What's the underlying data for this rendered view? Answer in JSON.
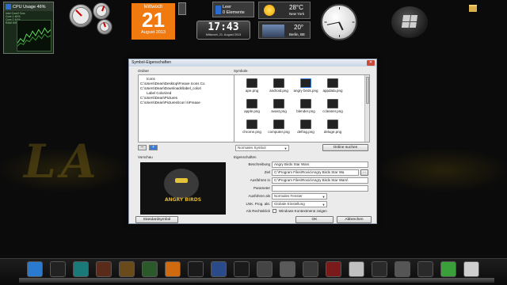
{
  "desktop": {
    "wallpaper_text": "LA"
  },
  "gadgets": {
    "cpu": {
      "title": "CPU Usage  46%",
      "lines": [
        "Intel Core2 Duo",
        "Core 1  46%",
        "Core 2  44%",
        "RAM 54%"
      ]
    },
    "calendar": {
      "weekday": "Mittwoch",
      "day": "21",
      "month_year": "August 2013"
    },
    "recycle_bin": {
      "line1": "Leer",
      "line2": "0 Elemente"
    },
    "digital_clock": {
      "time": "17:43",
      "date": "Mittwoch, 21. August 2013"
    },
    "weather": [
      {
        "temp": "28°C",
        "city": "New York"
      },
      {
        "temp": "20°",
        "city": "Berlin, BE"
      }
    ],
    "folder": {
      "label": ""
    }
  },
  "dialog": {
    "title": "Symbol-Eigenschaften",
    "close_glyph": "✕",
    "folders_group": "Ordner",
    "folder_tree": [
      "Icons",
      "C:\\Users\\Dean\\Desktop\\Freaxe Icons Co",
      "C:\\Users\\Dean\\Downloads\\label_colori",
      "Label Colorized",
      "C:\\Users\\Dean\\Pictures",
      "C:\\Users\\Dean\\Pictures\\Icon`s\\Freaxe"
    ],
    "nav_prev": "–",
    "nav_next": "+",
    "symbols_group": "Symbole",
    "symbols": [
      "ape.png",
      "android.png",
      "angry birds.png",
      "appdata.png",
      "apple.png",
      "avast.png",
      "blender.png",
      "ccleaner.png",
      "chrome.png",
      "computer.png",
      "defrag.png",
      "deluge.png"
    ],
    "sort_select": "Normales Symbol",
    "online_button": "Online suchen",
    "preview_group": "Vorschau",
    "preview_text": "ANGRY BIRDS",
    "properties_group": "Eigenschaften",
    "props": {
      "description_label": "Beschreibung",
      "description_value": "Angry Birds Star Wars",
      "target_label": "Ziel",
      "target_value": "C:\\Program Files\\Rovio\\Angry Birds Star Wa",
      "browse_label": "...",
      "run_in_label": "Ausführen in",
      "run_in_value": "C:\\Program Files\\Rovio\\Angry Birds Star Wars\\",
      "params_label": "Parameter",
      "params_value": "",
      "run_as_label": "Ausführen als",
      "run_as_value": "Normales Fenster",
      "lnk_label": "LNK. Prog. akt.",
      "lnk_value": "Globale Einstellung",
      "admin_label": "Als Rechtsklick",
      "admin_text": "Windows-Kontextmenü zeigen"
    },
    "default_button": "Standardsymbol",
    "ok_button": "OK",
    "cancel_button": "Abbrechen"
  },
  "dock": {
    "items": [
      {
        "name": "finder",
        "color": "#2a7ad0"
      },
      {
        "name": "app2",
        "color": "#222222"
      },
      {
        "name": "app3",
        "color": "#1a7a7a"
      },
      {
        "name": "app4",
        "color": "#5a2a1a"
      },
      {
        "name": "app5",
        "color": "#6a4a1a"
      },
      {
        "name": "app6",
        "color": "#2a5a2a"
      },
      {
        "name": "app7",
        "color": "#d06a10"
      },
      {
        "name": "app8",
        "color": "#1a1a1a"
      },
      {
        "name": "app9",
        "color": "#2a4a8a"
      },
      {
        "name": "app10",
        "color": "#1a1a1a"
      },
      {
        "name": "app11",
        "color": "#444444"
      },
      {
        "name": "app12",
        "color": "#5a5a5a"
      },
      {
        "name": "app13",
        "color": "#3a3a3a"
      },
      {
        "name": "app14",
        "color": "#7a1a1a"
      },
      {
        "name": "app15",
        "color": "#c0c0c0"
      },
      {
        "name": "app16",
        "color": "#2a2a2a"
      },
      {
        "name": "app17",
        "color": "#555555"
      },
      {
        "name": "app18",
        "color": "#2a2a2a"
      },
      {
        "name": "app19",
        "color": "#3aa03a"
      },
      {
        "name": "app20",
        "color": "#cfcfcf"
      }
    ]
  }
}
